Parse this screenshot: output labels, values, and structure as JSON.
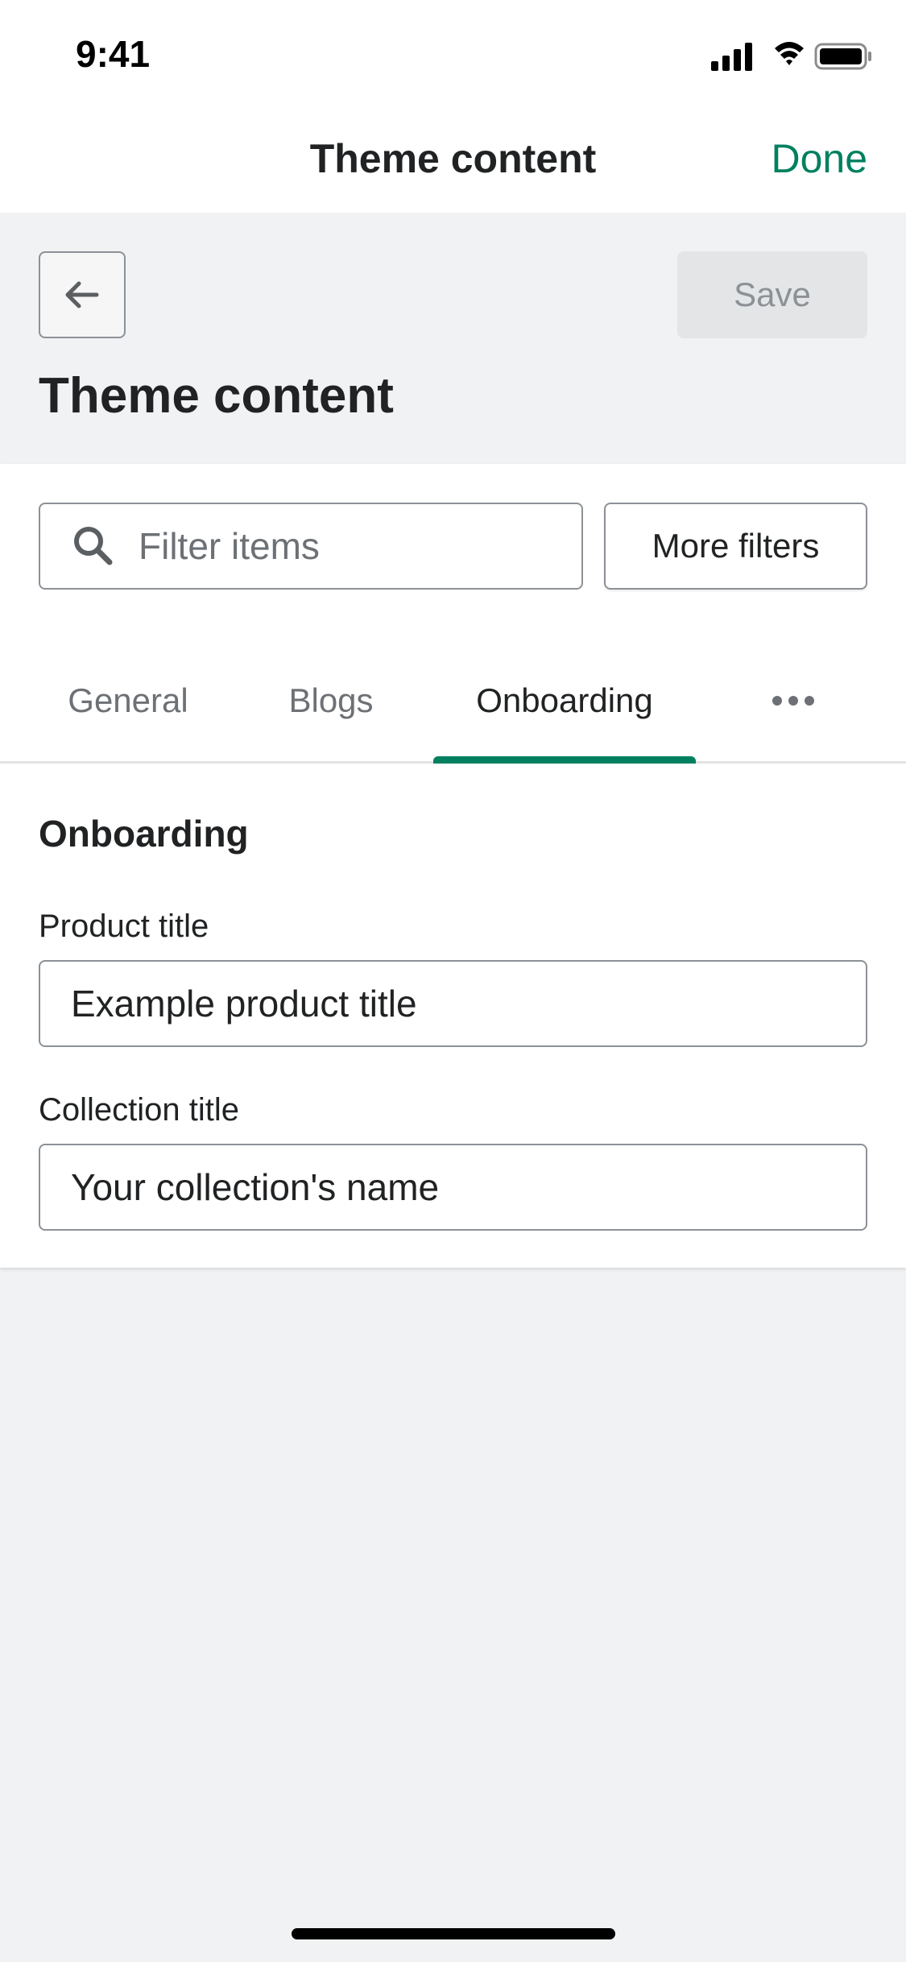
{
  "status_bar": {
    "time": "9:41"
  },
  "nav_bar": {
    "title": "Theme content",
    "done_label": "Done"
  },
  "page_header": {
    "save_label": "Save",
    "title": "Theme content"
  },
  "filters": {
    "search_placeholder": "Filter items",
    "more_filters_label": "More filters"
  },
  "tabs": [
    {
      "label": "General",
      "active": false
    },
    {
      "label": "Blogs",
      "active": false
    },
    {
      "label": "Onboarding",
      "active": true
    }
  ],
  "section": {
    "title": "Onboarding",
    "fields": [
      {
        "label": "Product title",
        "value": "Example product title"
      },
      {
        "label": "Collection title",
        "value": "Your collection's name"
      }
    ]
  },
  "colors": {
    "accent": "#008060",
    "background": "#f1f2f4",
    "surface": "#ffffff",
    "border": "#8c9196",
    "text": "#202223",
    "subdued_text": "#6d7175",
    "disabled_bg": "#e4e5e7"
  },
  "icons": {
    "back": "arrow-left-icon",
    "search": "search-icon",
    "more": "horizontal-dots-icon",
    "signal": "cellular-signal-icon",
    "wifi": "wifi-icon",
    "battery": "battery-icon"
  }
}
